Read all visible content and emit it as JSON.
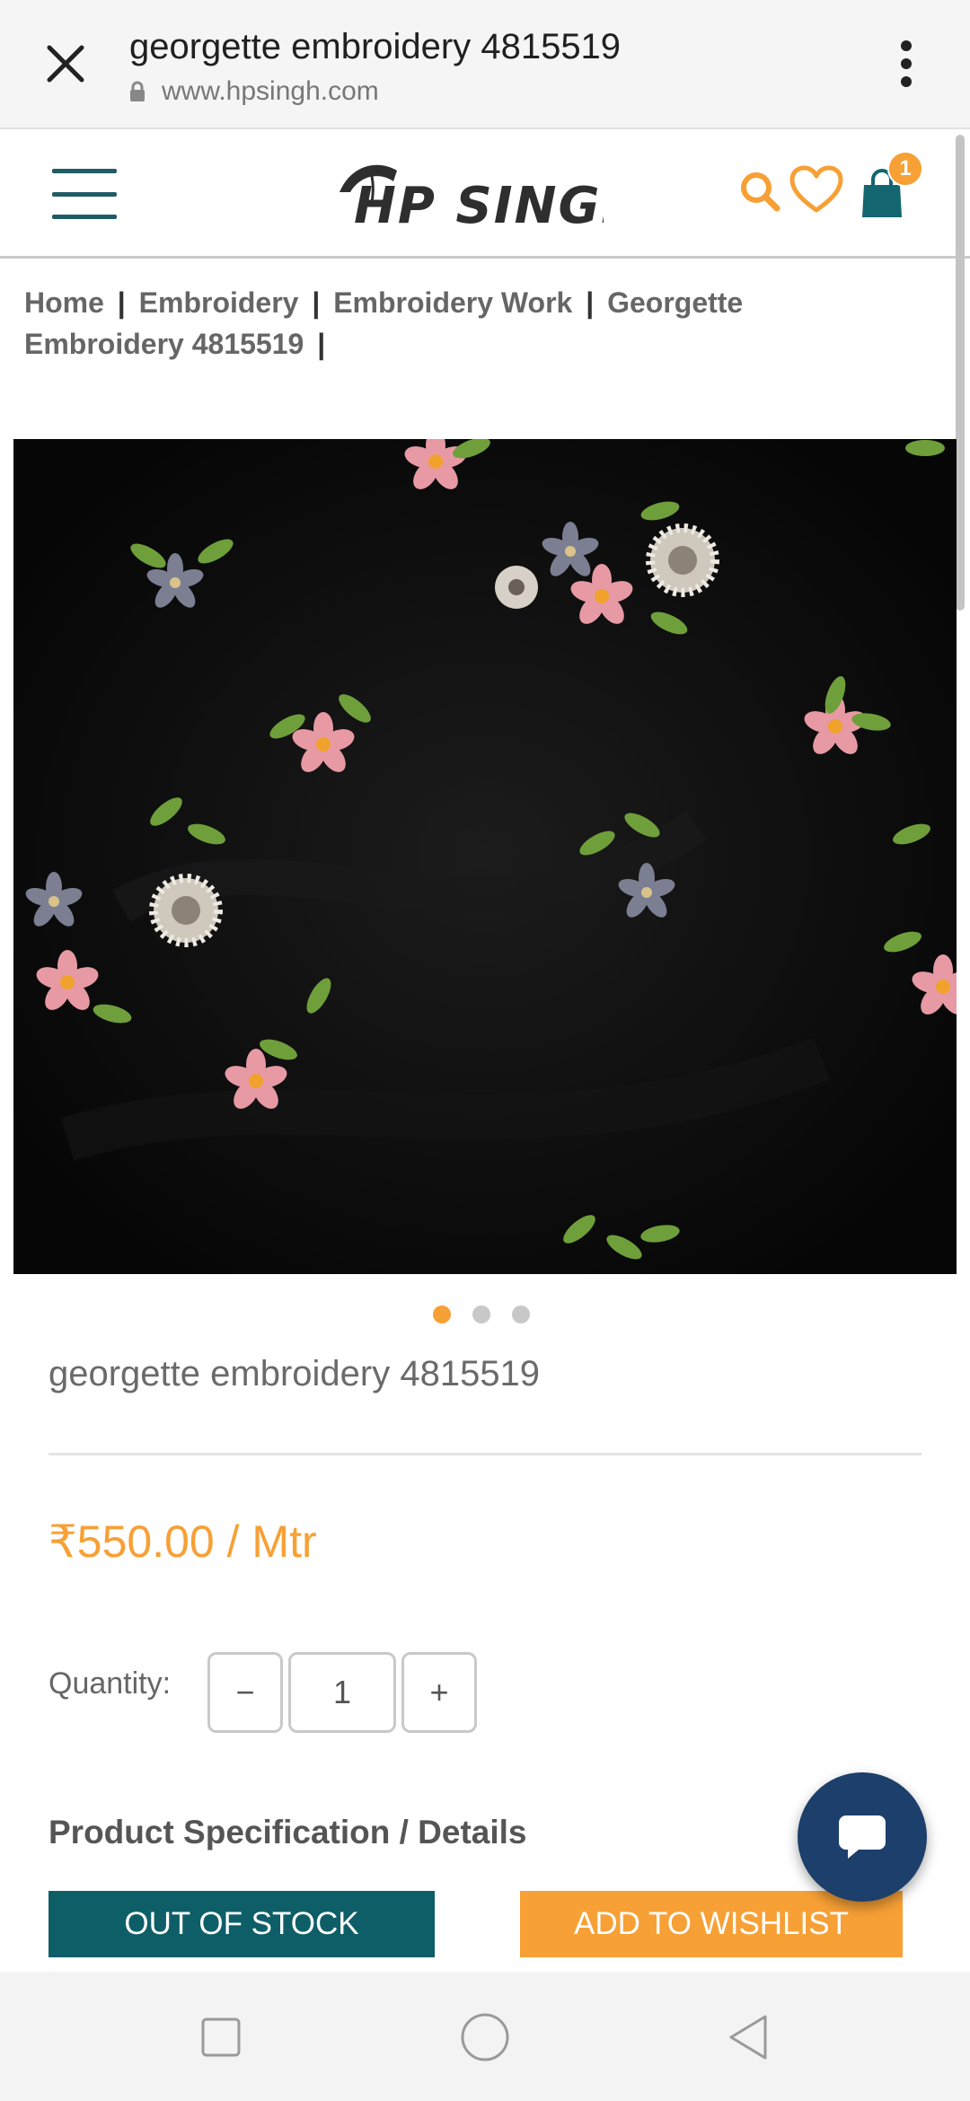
{
  "browser": {
    "title": "georgette embroidery 4815519",
    "url": "www.hpsingh.com",
    "icons": [
      "close-icon",
      "lock-icon",
      "more-vert-icon"
    ]
  },
  "header": {
    "logo_text": "HP SINGH",
    "cart_count": "1",
    "icons": [
      "menu-icon",
      "search-icon",
      "heart-icon",
      "shopping-bag-icon"
    ],
    "colors": {
      "teal": "#1f5c66",
      "orange": "#f7a035"
    }
  },
  "breadcrumb": {
    "items": [
      "Home",
      "Embroidery",
      "Embroidery Work",
      "Georgette Embroidery 4815519"
    ],
    "separator": "|"
  },
  "product": {
    "image_slides": 3,
    "active_slide": 1,
    "title": "georgette embroidery 4815519",
    "price": "₹550.00 / Mtr",
    "quantity_label": "Quantity:",
    "quantity_minus": "−",
    "quantity_value": "1",
    "quantity_plus": "+",
    "spec_heading": "Product Specification / Details"
  },
  "actions": {
    "out_of_stock": "OUT OF STOCK",
    "add_to_wishlist": "ADD TO WISHLIST",
    "colors": {
      "out_of_stock_bg": "#0e5e68",
      "wishlist_bg": "#f7a035"
    }
  },
  "chat": {
    "icon": "chat-bubble-icon",
    "bg": "#1c3f6b"
  },
  "nav": {
    "icons": [
      "recent-apps-icon",
      "home-icon",
      "back-icon"
    ]
  }
}
